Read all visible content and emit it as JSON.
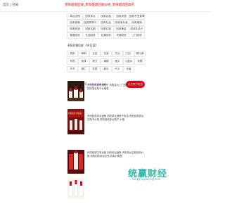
{
  "topbar": {
    "home_label": "首页 | 已知",
    "site_title": "贵阳烟酒回收_贵阳烟酒回收价格_贵阳烟酒回收店"
  },
  "categories": [
    "茅台空瓶",
    "回收茅台",
    "回收名酒",
    "回收洋酒",
    "回收冬虫夏草",
    "回收香烟",
    "回收购物卡",
    "回收礼品",
    "回收茅台酒",
    "回收烟酒",
    "回收老酒",
    "回收名烟",
    "回收红酒",
    "回收黄金",
    "回收礼品卡",
    "烟酒回收",
    "礼品回收",
    "名酒回收",
    "洋酒回收",
    "上门回收"
  ],
  "section": {
    "title": "贵阳同城回收 【市区县】"
  },
  "cities": [
    "贵阳",
    "南明",
    "云岩",
    "花溪",
    "乌当",
    "白云",
    "观山湖",
    "开阳",
    "息烽",
    "修文",
    "清镇",
    "遵义",
    "六盘水",
    "安顺",
    "毕节",
    "铜仁",
    "凯里",
    "都匀",
    "兴义",
    "全省"
  ],
  "contact": {
    "phone_text": "联系电话/微信号 17755166166",
    "call_button": "点击拨打电话"
  },
  "listings": [
    {
      "desc": "贵阳回收茅台酒瓶子 贵阳高价上门回收茅台空瓶 贵阳回收茅台瓶子价格表"
    },
    {
      "desc": "贵阳回收茅台酒瓶 回收茅台酒瓶子电话 贵阳回收茅台空瓶子价格 贵阳回收茅台瓶子 价格",
      "thumb_text": "收藏老酒·收藏品"
    },
    {
      "desc": "贵阳回收空茅台瓶 回收茅台酒瓶 贵阳茅台空瓶回收价格 贵阳回收茅台空瓶 回收价格表"
    },
    {
      "desc": ""
    }
  ],
  "watermark": {
    "brand": "统赢财经",
    "sub": "tongyingcaijing.com"
  },
  "colors": {
    "accent_red": "#e60012",
    "phone_purple": "#6a0dad",
    "watermark_teal": "#2fb7a8"
  }
}
